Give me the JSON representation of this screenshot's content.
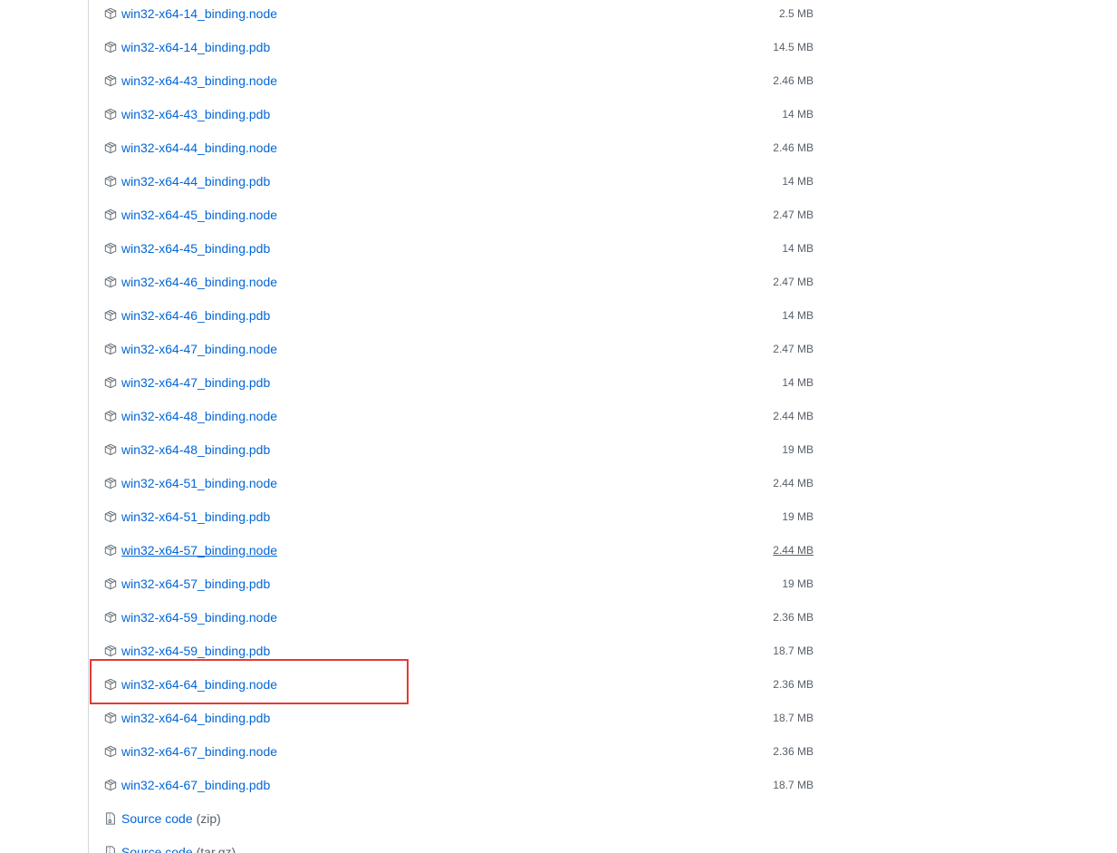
{
  "assets": [
    {
      "name": "win32-x64-14_binding.node",
      "size": "2.5 MB",
      "icon": "package-icon"
    },
    {
      "name": "win32-x64-14_binding.pdb",
      "size": "14.5 MB",
      "icon": "package-icon"
    },
    {
      "name": "win32-x64-43_binding.node",
      "size": "2.46 MB",
      "icon": "package-icon"
    },
    {
      "name": "win32-x64-43_binding.pdb",
      "size": "14 MB",
      "icon": "package-icon"
    },
    {
      "name": "win32-x64-44_binding.node",
      "size": "2.46 MB",
      "icon": "package-icon"
    },
    {
      "name": "win32-x64-44_binding.pdb",
      "size": "14 MB",
      "icon": "package-icon"
    },
    {
      "name": "win32-x64-45_binding.node",
      "size": "2.47 MB",
      "icon": "package-icon"
    },
    {
      "name": "win32-x64-45_binding.pdb",
      "size": "14 MB",
      "icon": "package-icon"
    },
    {
      "name": "win32-x64-46_binding.node",
      "size": "2.47 MB",
      "icon": "package-icon"
    },
    {
      "name": "win32-x64-46_binding.pdb",
      "size": "14 MB",
      "icon": "package-icon"
    },
    {
      "name": "win32-x64-47_binding.node",
      "size": "2.47 MB",
      "icon": "package-icon"
    },
    {
      "name": "win32-x64-47_binding.pdb",
      "size": "14 MB",
      "icon": "package-icon"
    },
    {
      "name": "win32-x64-48_binding.node",
      "size": "2.44 MB",
      "icon": "package-icon"
    },
    {
      "name": "win32-x64-48_binding.pdb",
      "size": "19 MB",
      "icon": "package-icon"
    },
    {
      "name": "win32-x64-51_binding.node",
      "size": "2.44 MB",
      "icon": "package-icon"
    },
    {
      "name": "win32-x64-51_binding.pdb",
      "size": "19 MB",
      "icon": "package-icon"
    },
    {
      "name": "win32-x64-57_binding.node",
      "size": "2.44 MB",
      "icon": "package-icon"
    },
    {
      "name": "win32-x64-57_binding.pdb",
      "size": "19 MB",
      "icon": "package-icon"
    },
    {
      "name": "win32-x64-59_binding.node",
      "size": "2.36 MB",
      "icon": "package-icon"
    },
    {
      "name": "win32-x64-59_binding.pdb",
      "size": "18.7 MB",
      "icon": "package-icon"
    },
    {
      "name": "win32-x64-64_binding.node",
      "size": "2.36 MB",
      "icon": "package-icon"
    },
    {
      "name": "win32-x64-64_binding.pdb",
      "size": "18.7 MB",
      "icon": "package-icon"
    },
    {
      "name": "win32-x64-67_binding.node",
      "size": "2.36 MB",
      "icon": "package-icon"
    },
    {
      "name": "win32-x64-67_binding.pdb",
      "size": "18.7 MB",
      "icon": "package-icon"
    }
  ],
  "source_code": [
    {
      "name": "Source code",
      "suffix": "(zip)",
      "icon": "file-zip-icon"
    },
    {
      "name": "Source code",
      "suffix": "(tar.gz)",
      "icon": "file-zip-icon"
    }
  ],
  "hovered_asset": "win32-x64-57_binding.node",
  "highlighted_asset": "win32-x64-64_binding.node",
  "colors": {
    "link": "#0366d6",
    "size_text": "#586069",
    "icon": "#6a737d",
    "highlight_border": "#e53935",
    "timeline": "#d1d5da"
  }
}
